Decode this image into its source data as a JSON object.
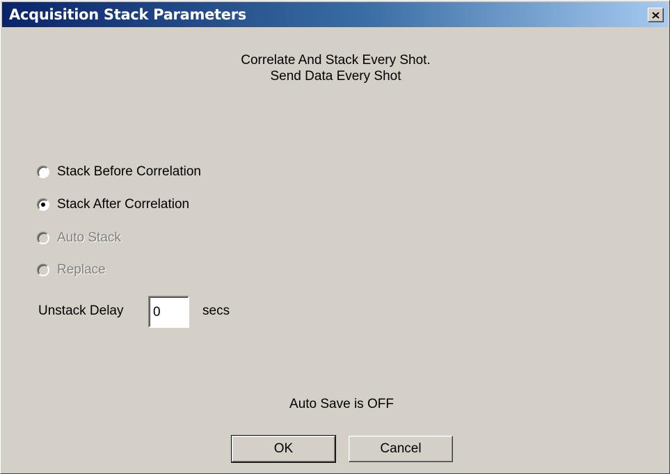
{
  "window": {
    "title": "Acquisition Stack Parameters"
  },
  "info": {
    "line1": "Correlate And Stack Every Shot.",
    "line2": "Send Data Every Shot"
  },
  "stack_mode": {
    "options": [
      {
        "label": "Stack Before Correlation",
        "checked": false,
        "enabled": true
      },
      {
        "label": "Stack After Correlation",
        "checked": true,
        "enabled": true
      },
      {
        "label": "Auto Stack",
        "checked": false,
        "enabled": false
      },
      {
        "label": "Replace",
        "checked": false,
        "enabled": false
      }
    ]
  },
  "unstack_delay": {
    "label": "Unstack Delay",
    "value": "0",
    "unit": "secs"
  },
  "status": {
    "auto_save": "Auto Save is OFF"
  },
  "buttons": {
    "ok_label": "OK",
    "cancel_label": "Cancel"
  },
  "icons": {
    "close": "close-icon"
  }
}
